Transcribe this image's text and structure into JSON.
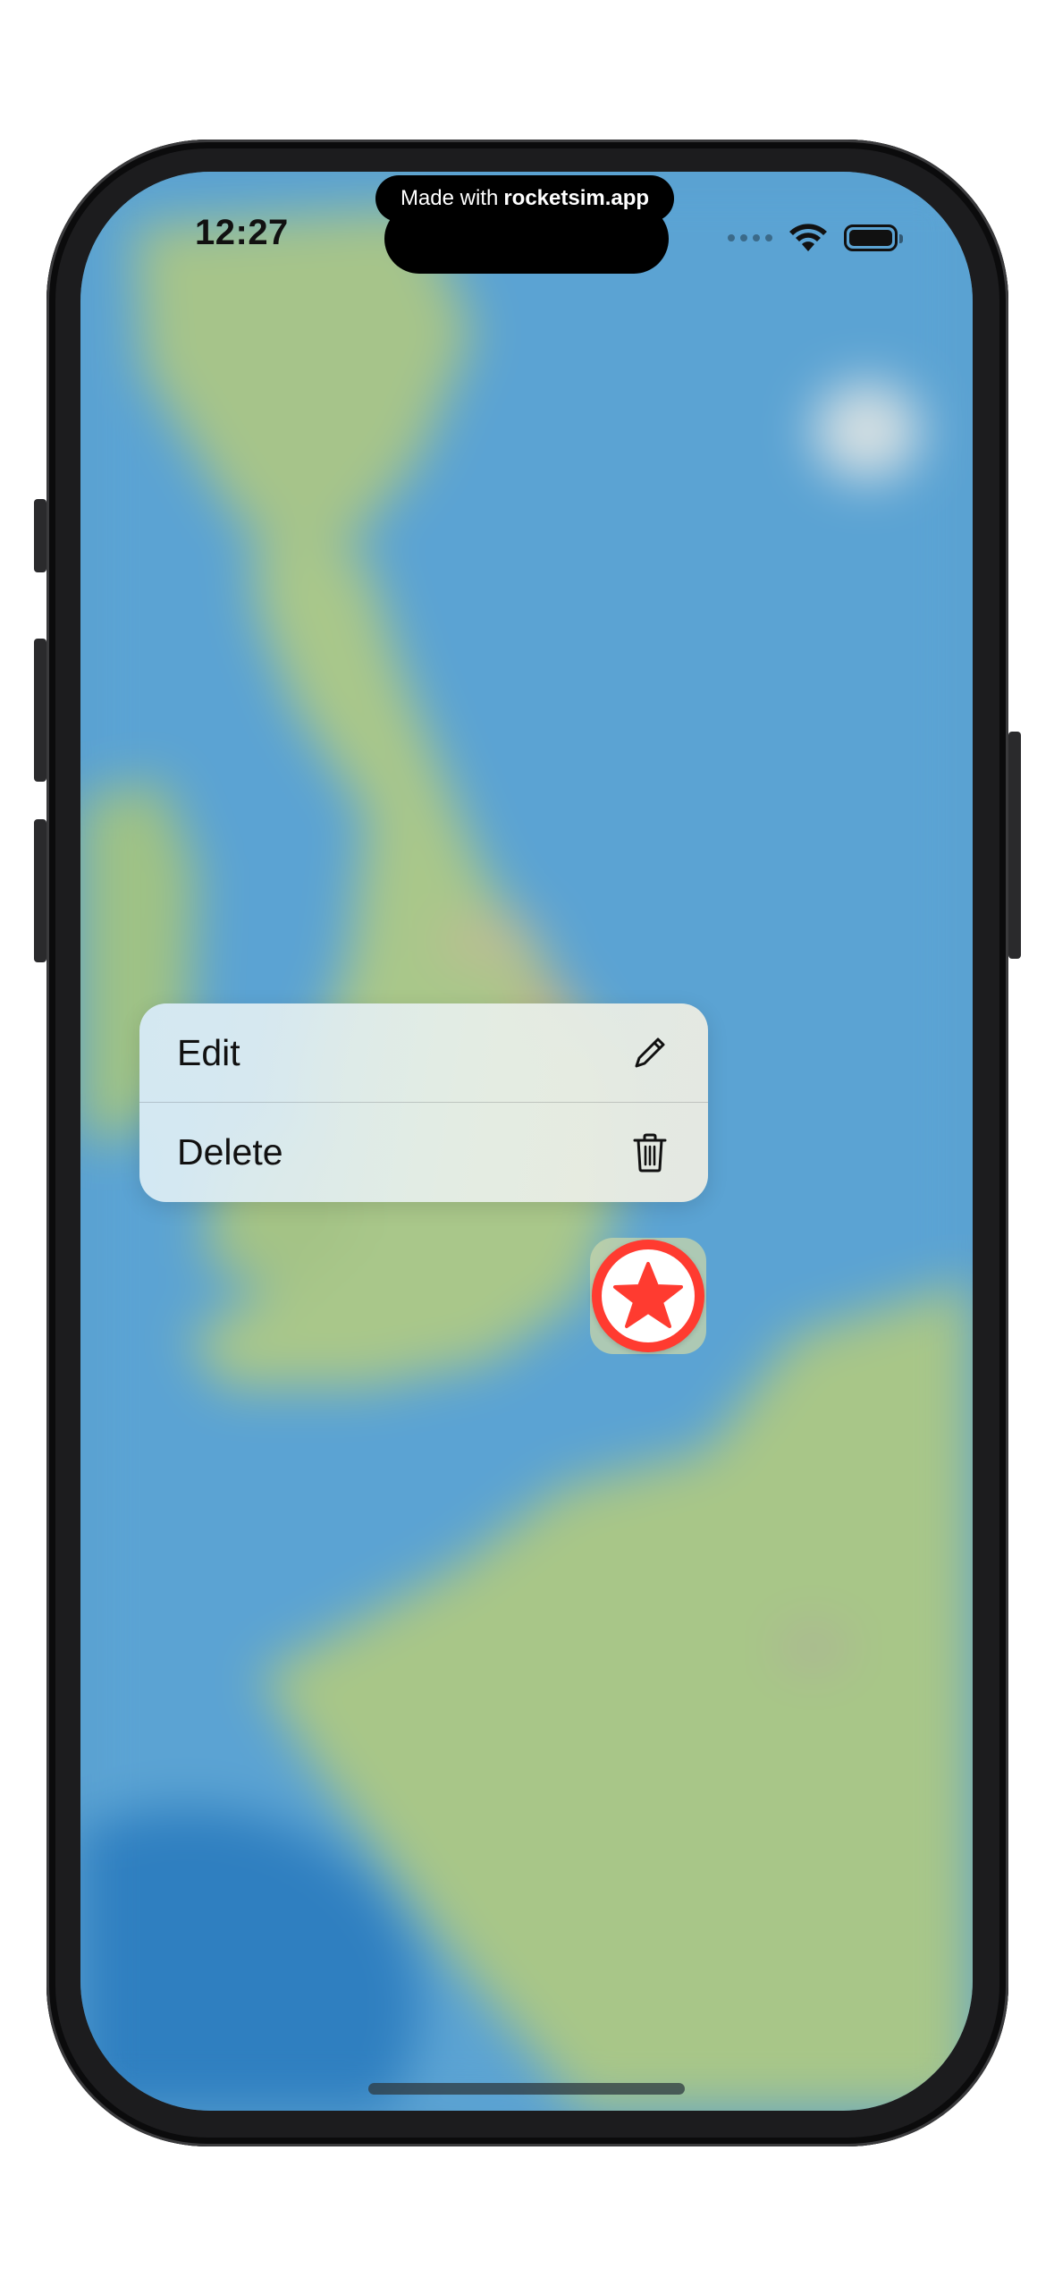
{
  "status_bar": {
    "time": "12:27",
    "banner_prefix": "Made with",
    "banner_brand": "rocketsim.app",
    "icons": [
      "cellular-signal-icon",
      "wifi-icon",
      "battery-icon"
    ]
  },
  "context_menu": {
    "items": [
      {
        "label": "Edit",
        "icon": "pencil-icon"
      },
      {
        "label": "Delete",
        "icon": "trash-icon"
      }
    ]
  },
  "map_pin": {
    "icon": "star-icon",
    "color": "#ff3b30"
  },
  "colors": {
    "water": "#5aa0d0",
    "land": "#a3c486",
    "pin_red": "#ff3b30"
  }
}
